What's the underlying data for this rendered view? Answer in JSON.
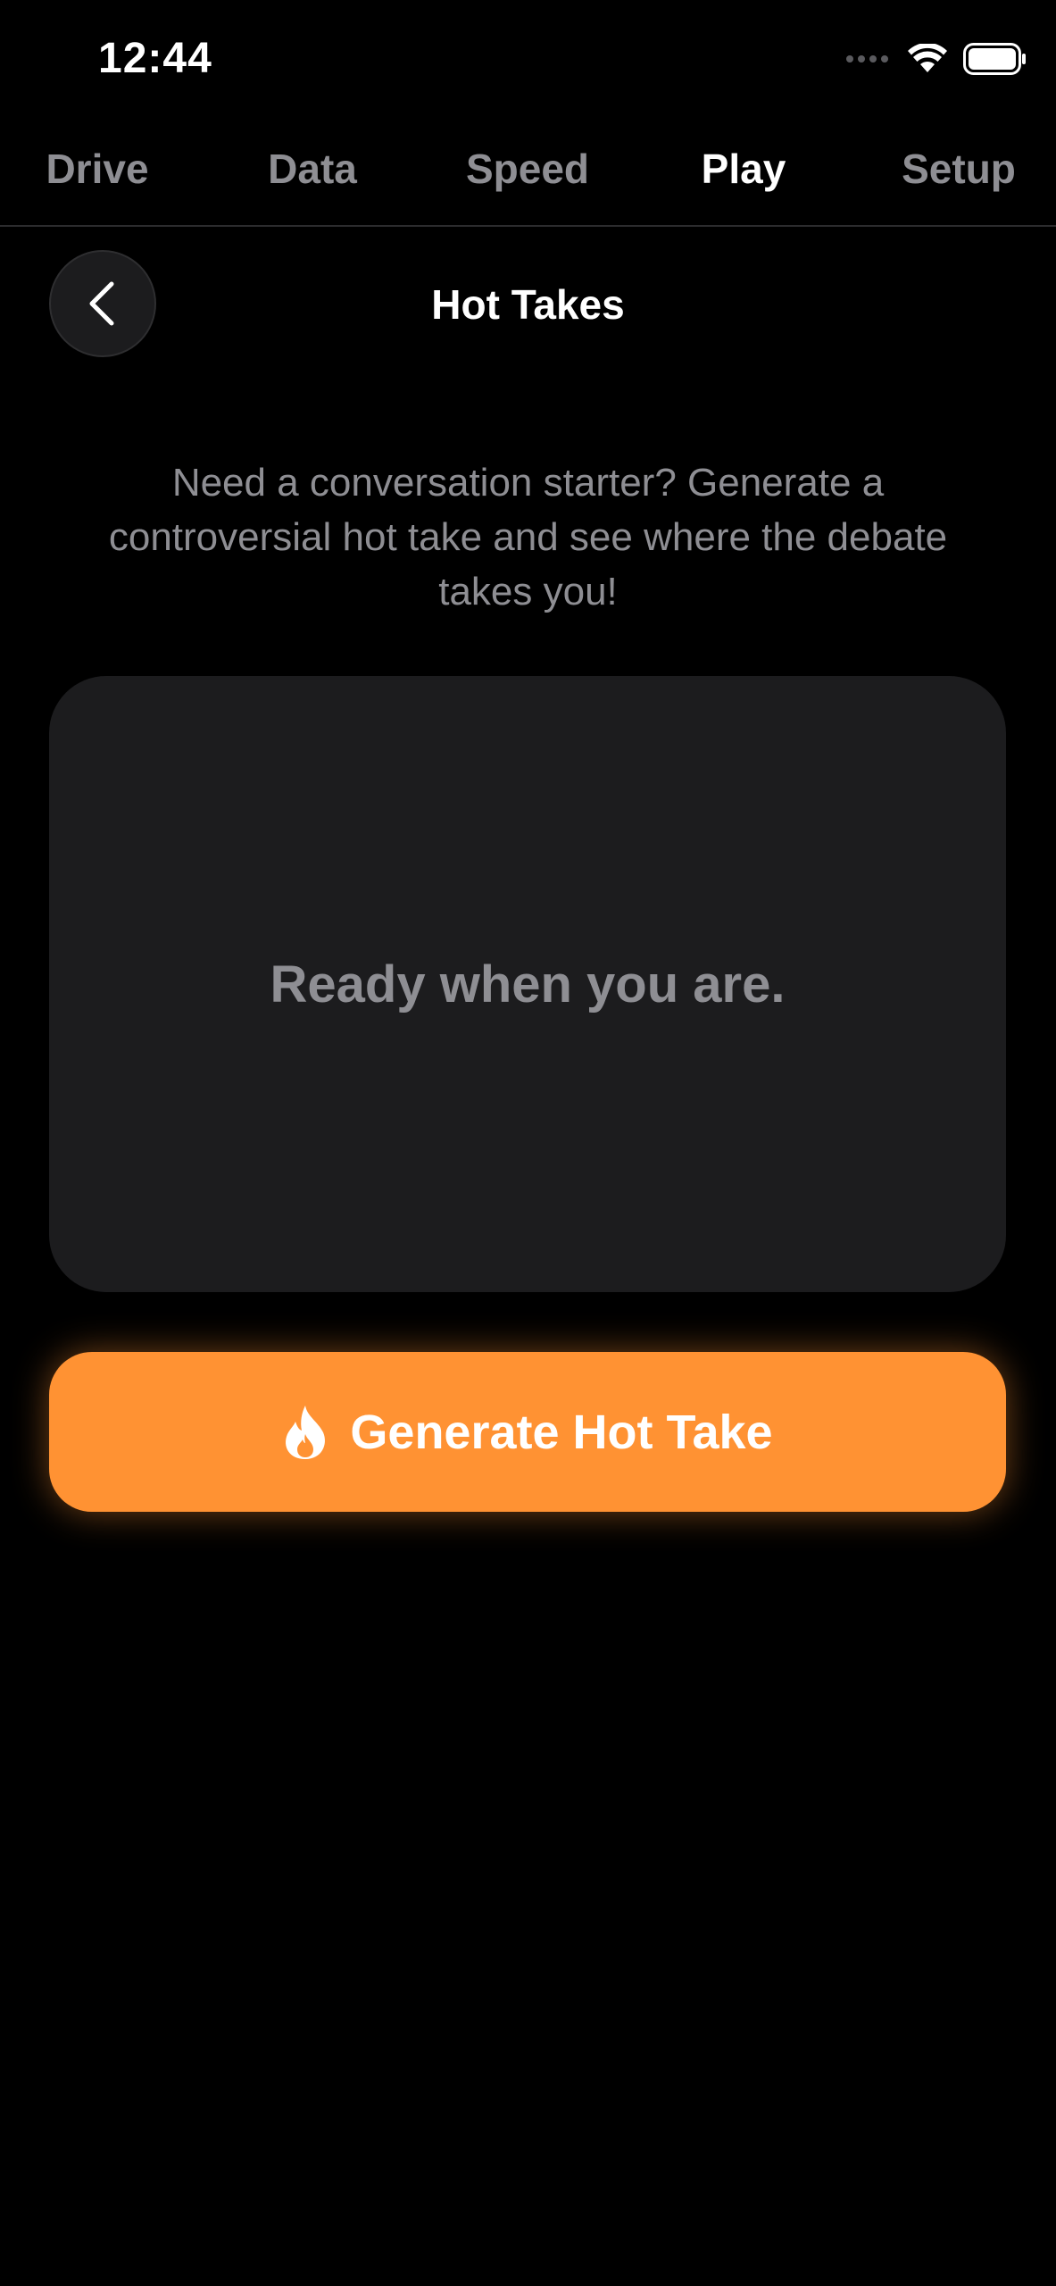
{
  "status_bar": {
    "time": "12:44"
  },
  "tabs": [
    {
      "label": "Drive",
      "active": false
    },
    {
      "label": "Data",
      "active": false
    },
    {
      "label": "Speed",
      "active": false
    },
    {
      "label": "Play",
      "active": true
    },
    {
      "label": "Setup",
      "active": false
    }
  ],
  "header": {
    "back_icon": "chevron-left-icon",
    "title": "Hot Takes"
  },
  "description": "Need a conversation starter? Generate a controversial hot take and see where the debate takes you!",
  "card": {
    "text": "Ready when you are."
  },
  "generate_button": {
    "icon": "flame-icon",
    "label": "Generate Hot Take"
  },
  "colors": {
    "background": "#000000",
    "accent": "#ff9233",
    "card": "#1c1c1e",
    "muted_text": "#8e8e93"
  }
}
